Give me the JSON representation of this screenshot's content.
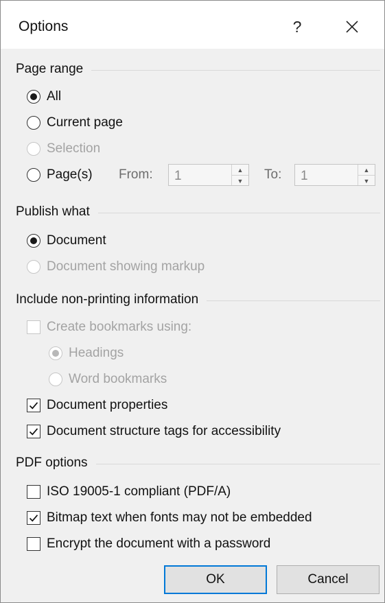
{
  "dialog": {
    "title": "Options",
    "help_label": "?"
  },
  "page_range": {
    "header": "Page range",
    "all_label": "All",
    "current_page_label": "Current page",
    "selection_label": "Selection",
    "pages_label": "Page(s)",
    "from_label": "From:",
    "from_value": "1",
    "to_label": "To:",
    "to_value": "1"
  },
  "publish_what": {
    "header": "Publish what",
    "document_label": "Document",
    "markup_label": "Document showing markup"
  },
  "non_printing": {
    "header": "Include non-printing information",
    "bookmarks_label": "Create bookmarks using:",
    "headings_label": "Headings",
    "word_bookmarks_label": "Word bookmarks",
    "doc_properties_label": "Document properties",
    "structure_tags_label": "Document structure tags for accessibility"
  },
  "pdf_options": {
    "header": "PDF options",
    "iso_label": "ISO 19005-1 compliant (PDF/A)",
    "bitmap_label": "Bitmap text when fonts may not be embedded",
    "encrypt_label": "Encrypt the document with a password"
  },
  "buttons": {
    "ok": "OK",
    "cancel": "Cancel"
  },
  "state": {
    "page_range_selected": "All",
    "publish_selected": "Document",
    "bookmarks_selected": "Headings",
    "create_bookmarks": false,
    "document_properties": true,
    "structure_tags": true,
    "iso_compliant": false,
    "bitmap_text": true,
    "encrypt": false
  },
  "colors": {
    "accent": "#0078d7",
    "dialog_bg": "#f0f0f0",
    "disabled_text": "#a3a3a3"
  }
}
